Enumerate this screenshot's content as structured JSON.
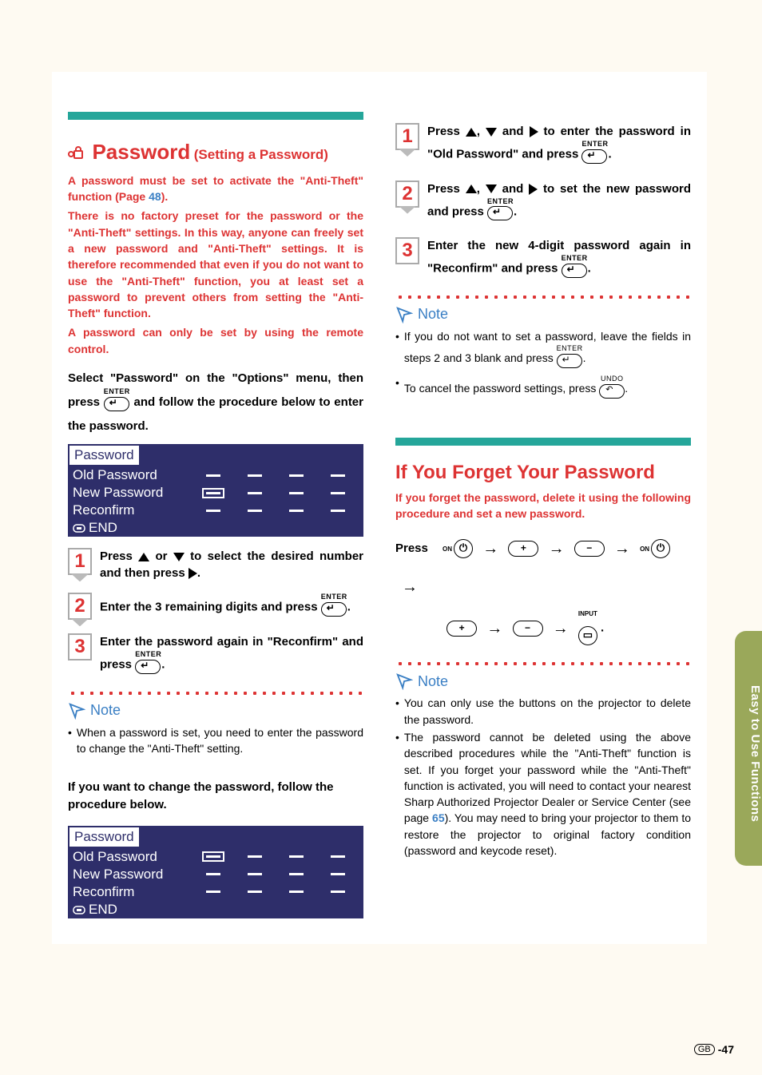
{
  "sideTab": "Easy to Use Functions",
  "pageNum": {
    "region": "GB",
    "num": "-47"
  },
  "left": {
    "title": "Password",
    "subtitle": " (Setting a Password)",
    "para1a": "A password must be set to activate the \"Anti-Theft\" function (Page ",
    "para1_link": "48",
    "para1b": ").",
    "para2": "There is no factory preset for the password or the \"Anti-Theft\" settings. In this way, anyone can freely set a new password and \"Anti-Theft\" settings. It is therefore recommended that even if you do not want to use the \"Anti-Theft\" function, you at least set a password to prevent others from setting the \"Anti-Theft\" function.",
    "para3": "A password can only be set by using the remote control.",
    "select_a": "Select \"Password\" on the \"Options\" menu, then press ",
    "select_b": " and follow the procedure below to enter the password.",
    "menu": {
      "header": "Password",
      "rows": [
        "Old Password",
        "New Password",
        "Reconfirm"
      ],
      "end": "END"
    },
    "steps": [
      {
        "n": "1",
        "a": "Press ",
        "b": " or ",
        "c": " to select the desired number and then press ",
        "d": "."
      },
      {
        "n": "2",
        "a": "Enter the 3 remaining digits and press ",
        "d": "."
      },
      {
        "n": "3",
        "a": "Enter the password again in \"Reconfirm\" and press ",
        "d": "."
      }
    ],
    "noteLabel": "Note",
    "noteItems": [
      "When a password is set, you need to enter the password to change the \"Anti-Theft\" setting."
    ],
    "changeIntro": "If you want to change the password, follow the procedure below."
  },
  "right": {
    "steps": [
      {
        "n": "1",
        "a": "Press ",
        "mid": ", ",
        "and": " and ",
        "b": " to enter the password in \"Old Password\" and press ",
        "end": "."
      },
      {
        "n": "2",
        "a": "Press ",
        "mid": ", ",
        "and": " and ",
        "b": " to set the new password and press ",
        "end": "."
      },
      {
        "n": "3",
        "a": "Enter the new 4-digit password again in \"Reconfirm\" and press ",
        "end": "."
      }
    ],
    "noteLabel": "Note",
    "noteItems": [
      {
        "a": "If you do not want to set a password, leave the fields in steps 2 and 3 blank and press ",
        "end": "."
      },
      {
        "a": "To cancel the password settings, press ",
        "end": "."
      }
    ],
    "forgot": {
      "title": "If You Forget Your Password",
      "intro": "If you forget the password, delete it using the following procedure and set a new password.",
      "pressLabel": "Press",
      "noteLabel": "Note",
      "noteItems": [
        "You can only use the buttons on the projector to delete the password.",
        {
          "a": "The password cannot be deleted using the above described procedures while the \"Anti-Theft\" function is set. If you forget your password while the \"Anti-Theft\" function is activated, you will need to contact your nearest Sharp Authorized Projector Dealer or Service Center (see page ",
          "link": "65",
          "b": "). You may need to bring your projector to them to restore the projector to original factory condition (password and keycode reset)."
        }
      ]
    }
  },
  "labels": {
    "enter": "ENTER",
    "undo": "UNDO",
    "input": "INPUT",
    "on": "ON"
  }
}
